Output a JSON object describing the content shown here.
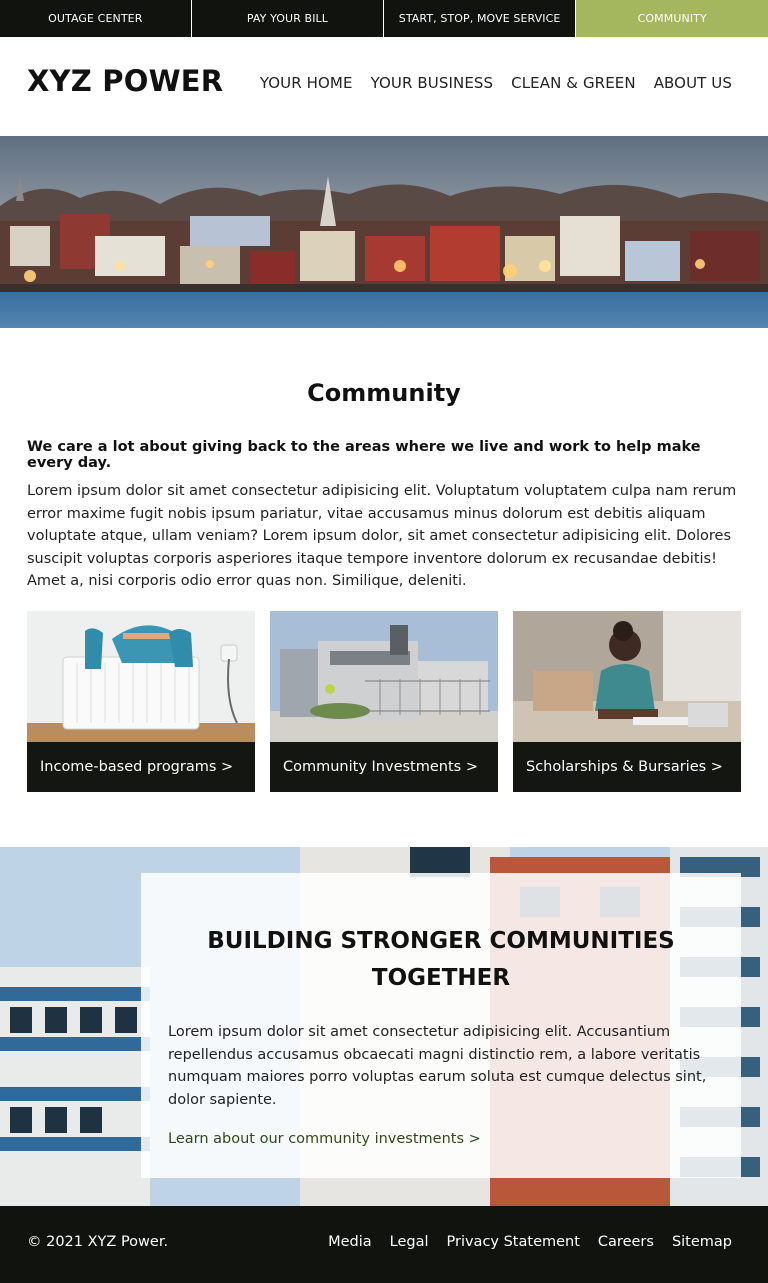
{
  "topbar": {
    "items": [
      {
        "label": "OUTAGE CENTER"
      },
      {
        "label": "PAY YOUR BILL"
      },
      {
        "label": "START, STOP, MOVE SERVICE"
      },
      {
        "label": "COMMUNITY"
      }
    ],
    "active_color": "#a4b75f",
    "bar_color": "#11130f"
  },
  "header": {
    "logo": "XYZ POWER",
    "nav": [
      {
        "label": "YOUR HOME"
      },
      {
        "label": "YOUR BUSINESS"
      },
      {
        "label": "CLEAN & GREEN"
      },
      {
        "label": "ABOUT US"
      }
    ]
  },
  "community": {
    "title": "Community",
    "lead": "We care a lot about giving back to the areas where we live and work to help make every day.",
    "body": "Lorem ipsum dolor sit amet consectetur adipisicing elit. Voluptatum voluptatem culpa nam rerum error maxime fugit nobis ipsum pariatur, vitae accusamus minus dolorum est debitis aliquam voluptate atque, ullam veniam? Lorem ipsum dolor, sit amet consectetur adipisicing elit. Dolores suscipit voluptas corporis asperiores itaque tempore inventore dolorum ex recusandae debitis! Amet a, nisi corporis odio error quas non. Similique, deleniti.",
    "cards": [
      {
        "label": "Income-based programs >"
      },
      {
        "label": "Community Investments >"
      },
      {
        "label": "Scholarships & Bursaries >"
      }
    ]
  },
  "promo": {
    "title": "BUILDING STRONGER COMMUNITIES TOGETHER",
    "text": "Lorem ipsum dolor sit amet consectetur adipisicing elit. Accusantium repellendus accusamus obcaecati magni distinctio rem, a labore veritatis numquam maiores porro voluptas earum soluta est cumque delectus sint, dolor sapiente.",
    "link": "Learn about our community investments >"
  },
  "footer": {
    "copyright": "© 2021 XYZ Power.",
    "links": [
      {
        "label": "Media"
      },
      {
        "label": "Legal"
      },
      {
        "label": "Privacy Statement"
      },
      {
        "label": "Careers"
      },
      {
        "label": "Sitemap"
      }
    ]
  }
}
